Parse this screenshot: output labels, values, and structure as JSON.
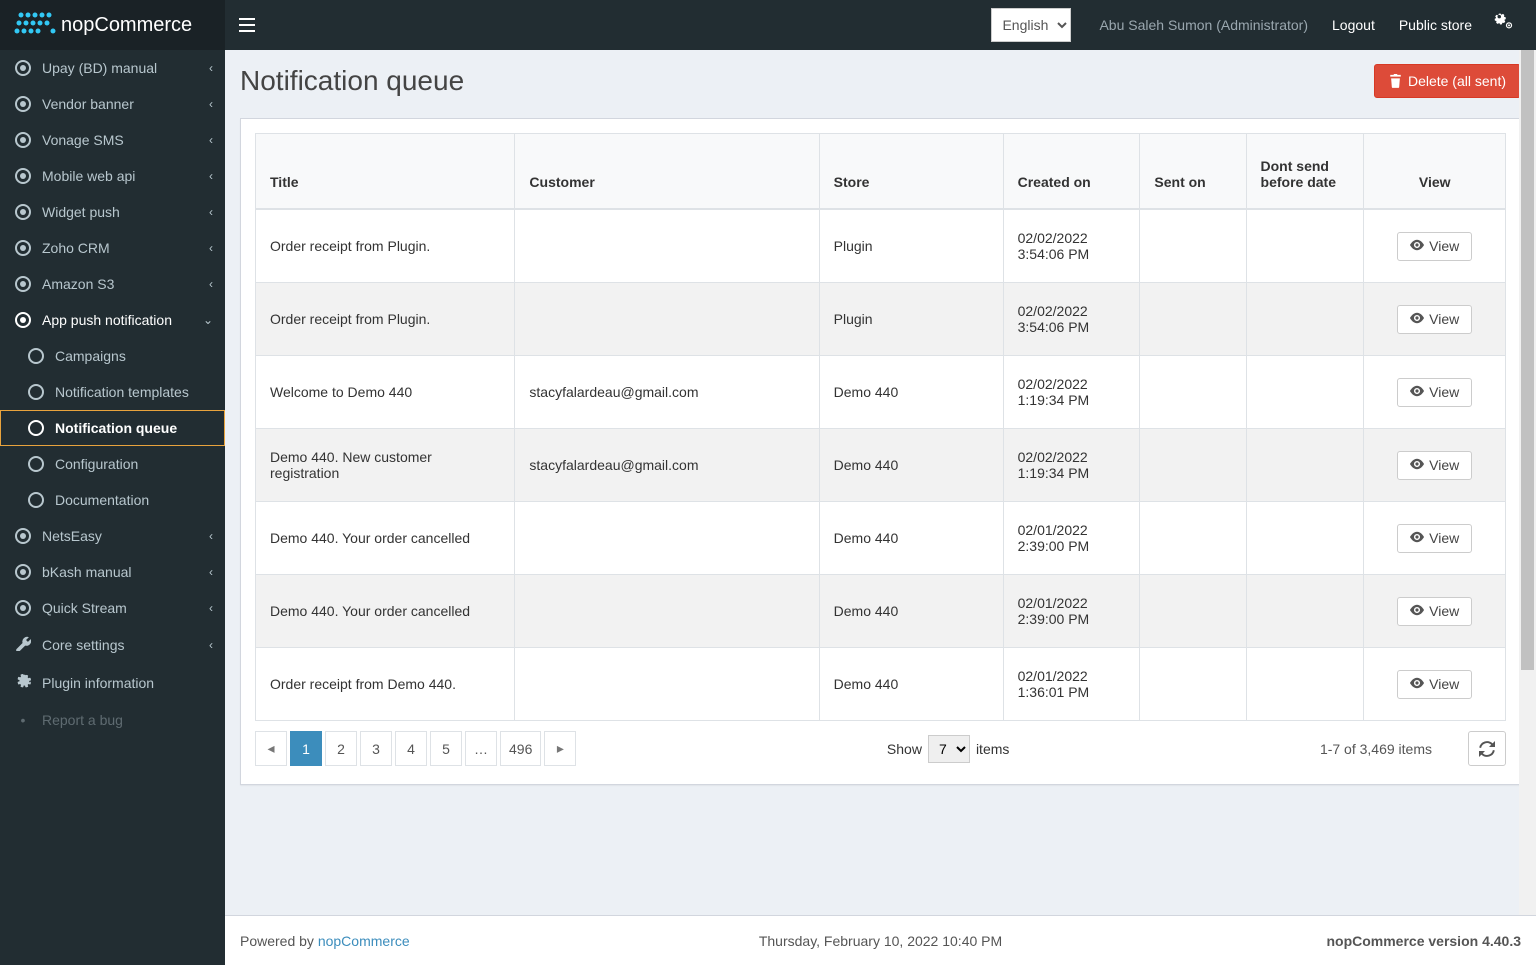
{
  "header": {
    "brand": "nopCommerce",
    "language_options": [
      "English"
    ],
    "language_selected": "English",
    "user": "Abu Saleh Sumon (Administrator)",
    "logout": "Logout",
    "public_store": "Public store"
  },
  "sidebar": {
    "items": [
      {
        "label": "Upay (BD) manual",
        "icon": "dot",
        "expandable": true
      },
      {
        "label": "Vendor banner",
        "icon": "dot",
        "expandable": true
      },
      {
        "label": "Vonage SMS",
        "icon": "dot",
        "expandable": true
      },
      {
        "label": "Mobile web api",
        "icon": "dot",
        "expandable": true
      },
      {
        "label": "Widget push",
        "icon": "dot",
        "expandable": true
      },
      {
        "label": "Zoho CRM",
        "icon": "dot",
        "expandable": true
      },
      {
        "label": "Amazon S3",
        "icon": "dot",
        "expandable": true
      },
      {
        "label": "App push notification",
        "icon": "dot",
        "expandable": true,
        "active": true,
        "children": [
          {
            "label": "Campaigns"
          },
          {
            "label": "Notification templates"
          },
          {
            "label": "Notification queue",
            "active": true,
            "highlight": true
          },
          {
            "label": "Configuration"
          },
          {
            "label": "Documentation"
          }
        ]
      },
      {
        "label": "NetsEasy",
        "icon": "dot",
        "expandable": true
      },
      {
        "label": "bKash manual",
        "icon": "dot",
        "expandable": true
      },
      {
        "label": "Quick Stream",
        "icon": "dot",
        "expandable": true
      },
      {
        "label": "Core settings",
        "icon": "wrench",
        "expandable": true
      },
      {
        "label": "Plugin information",
        "icon": "gear",
        "expandable": false
      },
      {
        "label": "Report a bug",
        "icon": "bug",
        "expandable": false,
        "faded": true
      }
    ]
  },
  "page": {
    "title": "Notification queue",
    "delete_btn": "Delete (all sent)"
  },
  "table": {
    "columns": [
      "Title",
      "Customer",
      "Store",
      "Created on",
      "Sent on",
      "Dont send before date",
      "View"
    ],
    "view_label": "View",
    "rows": [
      {
        "title": "Order receipt from Plugin.",
        "customer": "",
        "store": "Plugin",
        "created": "02/02/2022 3:54:06 PM",
        "sent": "",
        "dont": ""
      },
      {
        "title": "Order receipt from Plugin.",
        "customer": "",
        "store": "Plugin",
        "created": "02/02/2022 3:54:06 PM",
        "sent": "",
        "dont": ""
      },
      {
        "title": "Welcome to Demo 440",
        "customer": "stacyfalardeau@gmail.com",
        "store": "Demo 440",
        "created": "02/02/2022 1:19:34 PM",
        "sent": "",
        "dont": ""
      },
      {
        "title": "Demo 440. New customer registration",
        "customer": "stacyfalardeau@gmail.com",
        "store": "Demo 440",
        "created": "02/02/2022 1:19:34 PM",
        "sent": "",
        "dont": ""
      },
      {
        "title": "Demo 440. Your order cancelled",
        "customer": "",
        "store": "Demo 440",
        "created": "02/01/2022 2:39:00 PM",
        "sent": "",
        "dont": ""
      },
      {
        "title": "Demo 440. Your order cancelled",
        "customer": "",
        "store": "Demo 440",
        "created": "02/01/2022 2:39:00 PM",
        "sent": "",
        "dont": ""
      },
      {
        "title": "Order receipt from Demo 440.",
        "customer": "",
        "store": "Demo 440",
        "created": "02/01/2022 1:36:01 PM",
        "sent": "",
        "dont": ""
      }
    ],
    "pagination": {
      "pages": [
        "1",
        "2",
        "3",
        "4",
        "5",
        "…",
        "496"
      ],
      "active": "1"
    },
    "show_label": "Show",
    "show_value": "7",
    "items_label": "items",
    "record_info": "1-7 of 3,469 items"
  },
  "footer": {
    "powered": "Powered by ",
    "brandlink": "nopCommerce",
    "date": "Thursday, February 10, 2022 10:40 PM",
    "version": "nopCommerce version 4.40.3"
  }
}
